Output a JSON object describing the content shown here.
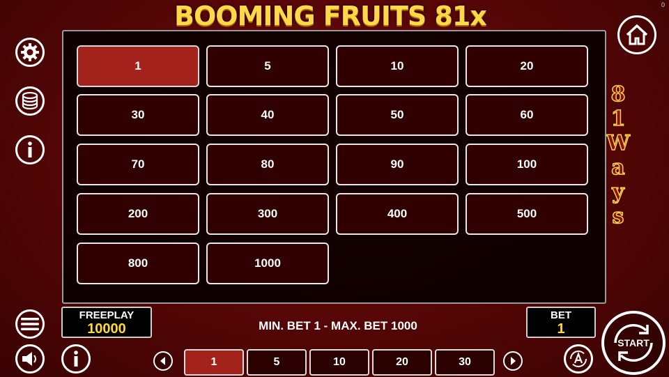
{
  "game": {
    "title": "BOOMING FRUITS 81x",
    "corner_counter": "0"
  },
  "bet_grid": {
    "rows": [
      [
        "1",
        "5",
        "10",
        "20"
      ],
      [
        "30",
        "40",
        "50",
        "60"
      ],
      [
        "70",
        "80",
        "90",
        "100"
      ],
      [
        "200",
        "300",
        "400",
        "500"
      ],
      [
        "800",
        "1000"
      ]
    ],
    "selected": "1"
  },
  "ways_badge": {
    "letters": [
      "8",
      "1",
      "W",
      "a",
      "y",
      "s"
    ]
  },
  "freeplay": {
    "label": "FREEPLAY",
    "value": "10000"
  },
  "bet": {
    "label": "BET",
    "value": "1"
  },
  "limits_text": "MIN. BET 1 - MAX. BET 1000",
  "quick_bets": {
    "values": [
      "1",
      "5",
      "10",
      "20",
      "30"
    ],
    "selected": "1"
  },
  "start_button": {
    "label": "START"
  },
  "icons": {
    "settings": "gear-icon",
    "coins": "coins-icon",
    "info": "info-icon",
    "menu": "menu-icon",
    "sound": "speaker-icon",
    "home": "home-icon",
    "autoplay": "autoplay-icon",
    "prev": "chevron-left-icon",
    "next": "chevron-right-icon"
  },
  "colors": {
    "selected": "#a3221b",
    "accent_gold": "#ffd83a",
    "background": "#5a0606"
  }
}
